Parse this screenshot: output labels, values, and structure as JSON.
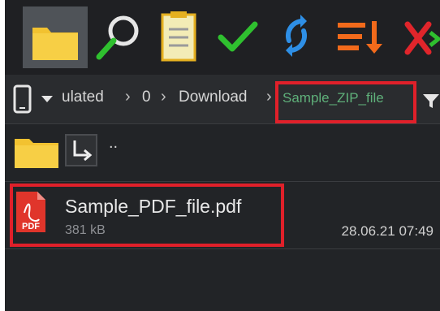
{
  "toolbar": {
    "icons": [
      "folder-icon",
      "search-icon",
      "clipboard-icon",
      "checkmark-icon",
      "sync-icon",
      "sort-icon",
      "cancel-icon"
    ]
  },
  "breadcrumb": {
    "segments": [
      "ulated",
      "0",
      "Download"
    ],
    "current": "Sample_ZIP_file"
  },
  "list": {
    "parent_label": "..",
    "file": {
      "name": "Sample_PDF_file.pdf",
      "size": "381 kB",
      "modified": "28.06.21 07:49",
      "type_badge": "PDF"
    }
  },
  "colors": {
    "highlight": "#e0202a",
    "current_path": "#5fb07a",
    "folder": "#f2c230",
    "pdf": "#e0352b"
  }
}
